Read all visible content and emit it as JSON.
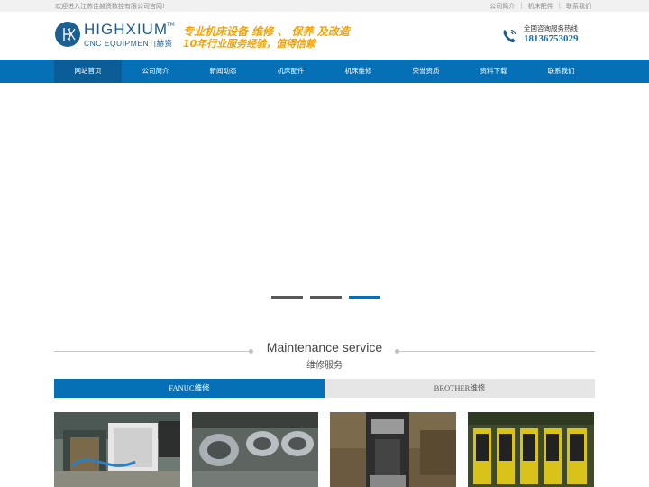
{
  "topbar": {
    "welcome": "欢迎进入江苏佳赫资数控有限公司官网!",
    "links": [
      "公司简介",
      "机床配件",
      "联系我们"
    ]
  },
  "header": {
    "brand": "HIGHXIUM",
    "brand_tm": "TM",
    "brand_sub": "CNC EQUIPMENT|赫资",
    "slogan_line1": "专业机床设备 维修 、 保养 及改造",
    "slogan_line2": "10年行业服务经验，值得信赖",
    "hotline_label": "全国咨询服务热线",
    "hotline_number": "18136753029",
    "accent_color": "#1f5d8e",
    "slogan_color": "#f0a30a"
  },
  "nav": {
    "items": [
      "网站首页",
      "公司简介",
      "新闻动态",
      "机床配件",
      "机床维修",
      "荣誉资质",
      "资料下载",
      "联系我们"
    ],
    "active_index": 0,
    "color": "#0570b5"
  },
  "banner": {
    "slides": 3,
    "active_slide": 3
  },
  "section": {
    "title_en": "Maintenance service",
    "title_cn": "维修服务"
  },
  "tabs": {
    "items": [
      "FANUC维修",
      "BROTHER维修"
    ],
    "active_index": 0
  },
  "products": [
    {
      "icon": "spindle-motor-photo"
    },
    {
      "icon": "bearings-photo"
    },
    {
      "icon": "spindle-photo"
    },
    {
      "icon": "servo-drives-photo"
    }
  ]
}
